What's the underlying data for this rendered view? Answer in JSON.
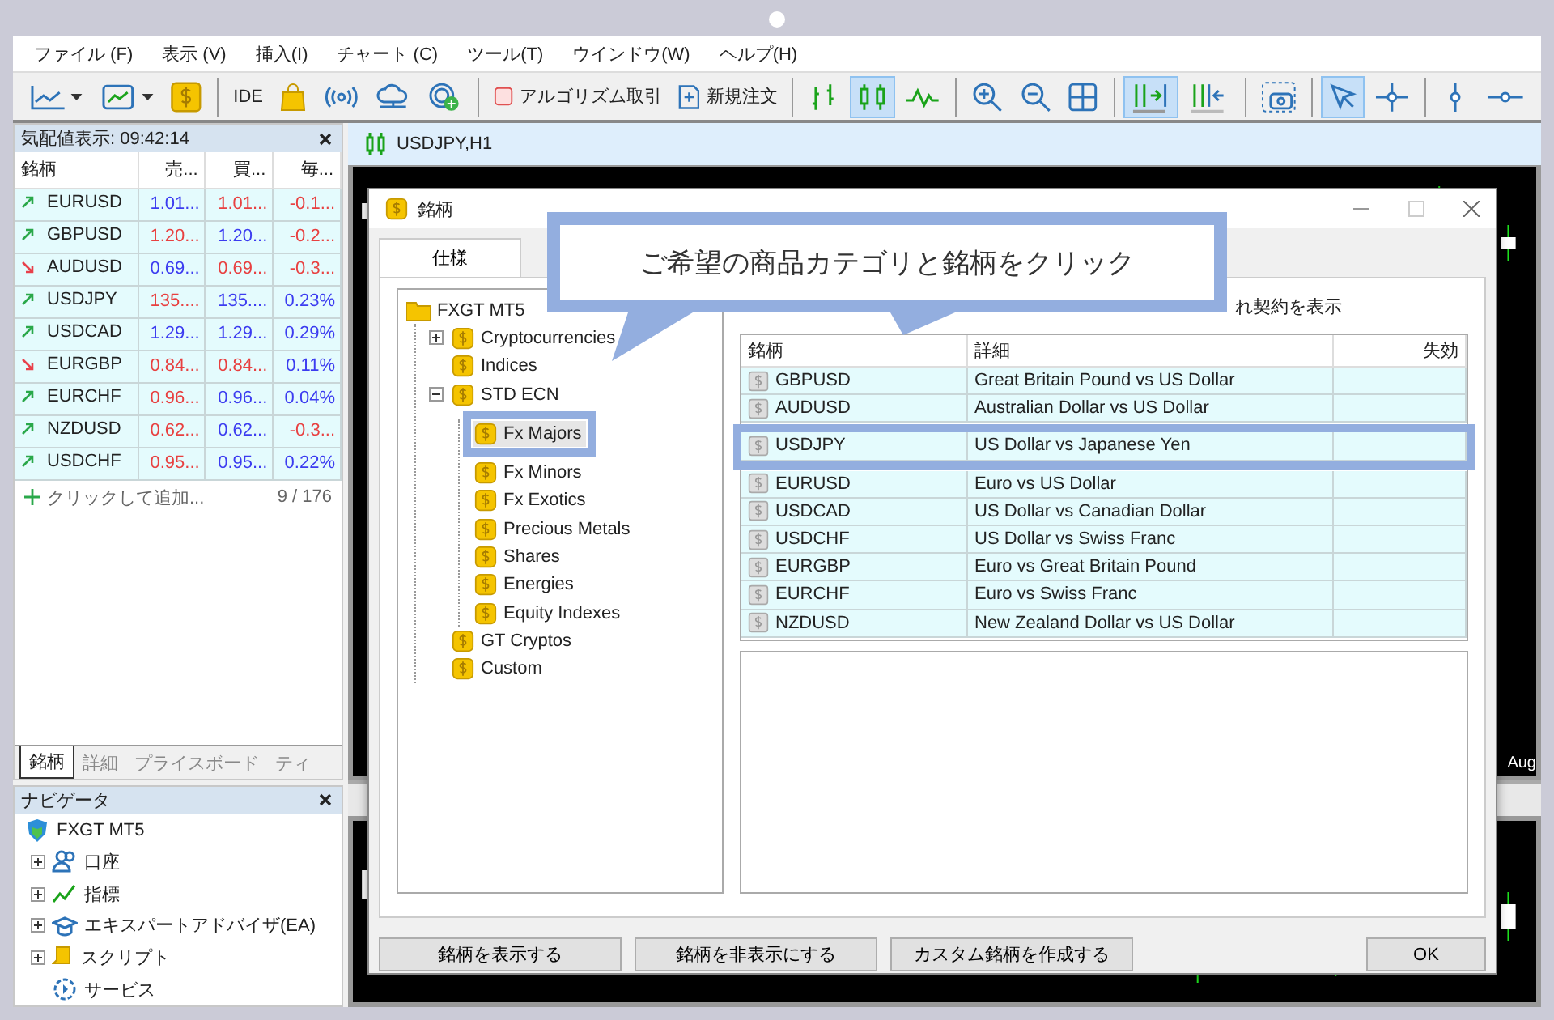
{
  "menu": [
    "ファイル (F)",
    "表示 (V)",
    "挿入(I)",
    "チャート (C)",
    "ツール(T)",
    "ウインドウ(W)",
    "ヘルプ(H)"
  ],
  "toolbar": [
    {
      "kind": "icon",
      "active": false
    },
    {
      "kind": "icon",
      "active": false
    },
    {
      "kind": "icon",
      "active": false
    },
    {
      "kind": "separator"
    },
    {
      "kind": "text",
      "label": "IDE"
    },
    {
      "kind": "icon",
      "active": false
    },
    {
      "kind": "icon",
      "active": false
    },
    {
      "kind": "icon",
      "active": false
    },
    {
      "kind": "icon",
      "active": false
    },
    {
      "kind": "separator"
    },
    {
      "kind": "text",
      "label": "アルゴリズム取引"
    },
    {
      "kind": "text",
      "label": "新規注文"
    },
    {
      "kind": "separator"
    },
    {
      "kind": "icon",
      "active": false
    },
    {
      "kind": "icon",
      "active": true
    },
    {
      "kind": "icon",
      "active": false
    },
    {
      "kind": "separator"
    },
    {
      "kind": "icon",
      "active": false
    },
    {
      "kind": "icon",
      "active": false
    },
    {
      "kind": "icon",
      "active": false
    },
    {
      "kind": "separator"
    },
    {
      "kind": "icon",
      "active": true
    },
    {
      "kind": "icon",
      "active": false
    },
    {
      "kind": "separator"
    },
    {
      "kind": "icon",
      "active": false
    },
    {
      "kind": "separator"
    },
    {
      "kind": "icon",
      "active": true
    },
    {
      "kind": "icon",
      "active": false
    },
    {
      "kind": "separator"
    },
    {
      "kind": "icon",
      "active": false
    },
    {
      "kind": "icon",
      "active": false
    }
  ],
  "market_watch": {
    "title": "気配値表示: 09:42:14",
    "columns": [
      "銘柄",
      "売...",
      "買...",
      "毎..."
    ],
    "rows": [
      {
        "symbol": "EURUSD",
        "rising": true,
        "bid": "1.01...",
        "bid_up": true,
        "ask": "1.01...",
        "ask_up": false,
        "change": "-0.1...",
        "change_up": false
      },
      {
        "symbol": "GBPUSD",
        "rising": true,
        "bid": "1.20...",
        "bid_up": false,
        "ask": "1.20...",
        "ask_up": true,
        "change": "-0.2...",
        "change_up": false
      },
      {
        "symbol": "AUDUSD",
        "rising": false,
        "bid": "0.69...",
        "bid_up": true,
        "ask": "0.69...",
        "ask_up": false,
        "change": "-0.3...",
        "change_up": false
      },
      {
        "symbol": "USDJPY",
        "rising": true,
        "bid": "135....",
        "bid_up": false,
        "ask": "135....",
        "ask_up": true,
        "change": "0.23%",
        "change_up": true
      },
      {
        "symbol": "USDCAD",
        "rising": true,
        "bid": "1.29...",
        "bid_up": true,
        "ask": "1.29...",
        "ask_up": true,
        "change": "0.29%",
        "change_up": true
      },
      {
        "symbol": "EURGBP",
        "rising": false,
        "bid": "0.84...",
        "bid_up": false,
        "ask": "0.84...",
        "ask_up": false,
        "change": "0.11%",
        "change_up": true
      },
      {
        "symbol": "EURCHF",
        "rising": true,
        "bid": "0.96...",
        "bid_up": false,
        "ask": "0.96...",
        "ask_up": true,
        "change": "0.04%",
        "change_up": true
      },
      {
        "symbol": "NZDUSD",
        "rising": true,
        "bid": "0.62...",
        "bid_up": false,
        "ask": "0.62...",
        "ask_up": true,
        "change": "-0.3...",
        "change_up": false
      },
      {
        "symbol": "USDCHF",
        "rising": true,
        "bid": "0.95...",
        "bid_up": false,
        "ask": "0.95...",
        "ask_up": true,
        "change": "0.22%",
        "change_up": true
      }
    ],
    "add_hint": "クリックして追加...",
    "count": "9 / 176",
    "tabs": [
      {
        "label": "銘柄",
        "selected": true
      },
      {
        "label": "詳細",
        "selected": false
      },
      {
        "label": "プライスボード",
        "selected": false
      },
      {
        "label": "ティ",
        "selected": false
      }
    ]
  },
  "navigator": {
    "title": "ナビゲータ",
    "root": "FXGT MT5",
    "items": [
      {
        "label": "口座",
        "expandable": true
      },
      {
        "label": "指標",
        "expandable": true
      },
      {
        "label": "エキスパートアドバイザ(EA)",
        "expandable": true
      },
      {
        "label": "スクリプト",
        "expandable": true
      },
      {
        "label": "サービス",
        "expandable": false
      }
    ]
  },
  "chart": {
    "title": "USDJPY,H1",
    "axis_label": "Aug"
  },
  "dialog": {
    "title": "銘柄",
    "tabs": [
      {
        "label": "仕様",
        "selected": true
      }
    ],
    "tree": {
      "label": "FXGT MT5",
      "children": [
        {
          "label": "Cryptocurrencies",
          "expanded": false
        },
        {
          "label": "Indices"
        },
        {
          "label": "STD ECN",
          "expanded": true,
          "children": [
            {
              "label": "Fx Majors",
              "selected": true
            },
            {
              "label": "Fx Minors",
              "selected": false
            },
            {
              "label": "Fx Exotics",
              "selected": false
            },
            {
              "label": "Precious Metals",
              "selected": false
            },
            {
              "label": "Shares",
              "selected": false
            },
            {
              "label": "Energies",
              "selected": false
            },
            {
              "label": "Equity Indexes",
              "selected": false
            }
          ]
        },
        {
          "label": "GT Cryptos"
        },
        {
          "label": "Custom"
        }
      ]
    },
    "checkbox_label": "れ契約を表示",
    "columns": [
      "銘柄",
      "詳細",
      "失効"
    ],
    "rows": [
      {
        "symbol": "GBPUSD",
        "description": "Great Britain Pound vs US Dollar",
        "highlighted": false
      },
      {
        "symbol": "AUDUSD",
        "description": "Australian Dollar vs US Dollar",
        "highlighted": false
      },
      {
        "symbol": "USDJPY",
        "description": "US Dollar vs Japanese Yen",
        "highlighted": true
      },
      {
        "symbol": "EURUSD",
        "description": "Euro vs US Dollar",
        "highlighted": false
      },
      {
        "symbol": "USDCAD",
        "description": "US Dollar vs Canadian Dollar",
        "highlighted": false
      },
      {
        "symbol": "USDCHF",
        "description": "US Dollar vs Swiss Franc",
        "highlighted": false
      },
      {
        "symbol": "EURGBP",
        "description": "Euro vs Great Britain Pound",
        "highlighted": false
      },
      {
        "symbol": "EURCHF",
        "description": "Euro vs Swiss Franc",
        "highlighted": false
      },
      {
        "symbol": "NZDUSD",
        "description": "New Zealand Dollar vs US Dollar",
        "highlighted": false
      }
    ],
    "buttons": [
      "銘柄を表示する",
      "銘柄を非表示にする",
      "カスタム銘柄を作成する"
    ],
    "ok": "OK"
  },
  "callout": {
    "text": "ご希望の商品カテゴリと銘柄をクリック"
  }
}
